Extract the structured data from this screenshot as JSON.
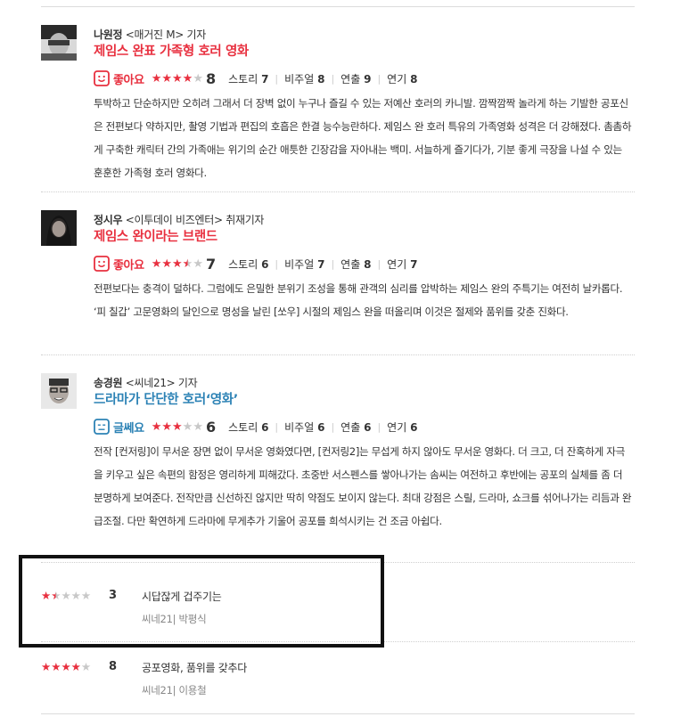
{
  "reviews": [
    {
      "author": "나원정",
      "outlet": "<매거진 M> 기자",
      "headline": "제임스 완표 가족형 호러 영화",
      "headline_color": "#e8303f",
      "verdict": "좋아요",
      "verdict_icon": "smile-face-icon",
      "stars": 4,
      "score": "8",
      "story_label": "스토리",
      "story": "7",
      "visual_label": "비주얼",
      "visual": "8",
      "direction_label": "연출",
      "direction": "9",
      "acting_label": "연기",
      "acting": "8",
      "text": "투박하고 단순하지만 오히려 그래서 더 장벽 없이 누구나 즐길 수 있는 저예산 호러의 카니발. 깜짝깜짝 놀라게 하는 기발한 공포신은 전편보다 약하지만, 촬영 기법과 편집의 호흡은 한결 능수능란하다. 제임스 완 호러 특유의 가족영화 성격은 더 강해졌다. 촘촘하게 구축한 캐릭터 간의 가족애는 위기의 순간 애틋한 긴장감을 자아내는 백미. 서늘하게 즐기다가, 기분 좋게 극장을 나설 수 있는 훈훈한 가족형 호러 영화다."
    },
    {
      "author": "정시우",
      "outlet": "<이투데이 비즈엔터> 취재기자",
      "headline": "제임스 완이라는 브랜드",
      "headline_color": "#e8303f",
      "verdict": "좋아요",
      "verdict_icon": "smile-face-icon",
      "stars": 3.5,
      "score": "7",
      "story_label": "스토리",
      "story": "6",
      "visual_label": "비주얼",
      "visual": "7",
      "direction_label": "연출",
      "direction": "8",
      "acting_label": "연기",
      "acting": "7",
      "text": "전편보다는 충격이 덜하다. 그럼에도 은밀한 분위기 조성을 통해 관객의 심리를 압박하는 제임스 완의 주특기는 여전히 날카롭다. ‘피 칠갑’ 고문영화의 달인으로 명성을 날린 [쏘우] 시절의 제임스 완을 떠올리며 이것은 절제와 품위를 갖춘 진화다."
    },
    {
      "author": "송경원",
      "outlet": "<씨네21> 기자",
      "headline": "드라마가 단단한 호러‘영화’",
      "headline_color": "#2c82b5",
      "verdict": "글쎄요",
      "verdict_icon": "neutral-face-icon",
      "stars": 3,
      "score": "6",
      "story_label": "스토리",
      "story": "6",
      "visual_label": "비주얼",
      "visual": "6",
      "direction_label": "연출",
      "direction": "6",
      "acting_label": "연기",
      "acting": "6",
      "text": "전작 [컨저링]이 무서운 장면 없이 무서운 영화였다면, [컨저링2]는 무섭게 하지 않아도 무서운 영화다. 더 크고, 더 잔혹하게 자극을 키우고 싶은 속편의 함정은 영리하게 피해갔다. 초중반 서스펜스를 쌓아나가는 솜씨는 여전하고 후반에는 공포의 실체를 좀 더 분명하게 보여준다. 전작만큼 신선하진 않지만 딱히 약점도 보이지 않는다. 최대 강점은 스릴, 드라마, 쇼크를 섞어나가는 리듬과 완급조절. 다만 확연하게 드라마에 무게추가 기울어 공포를 희석시키는 건 조금 아쉽다."
    }
  ],
  "short_reviews": [
    {
      "stars": 1.5,
      "score": "3",
      "title": "시답잖게 겁주기는",
      "source": "씨네21| 박평식"
    },
    {
      "stars": 4,
      "score": "8",
      "title": "공포영화, 품위를 갖추다",
      "source": "씨네21| 이용철"
    }
  ],
  "colors": {
    "accent_red": "#e8303f",
    "accent_blue": "#2c82b5",
    "star_off": "#c8c8c8"
  }
}
